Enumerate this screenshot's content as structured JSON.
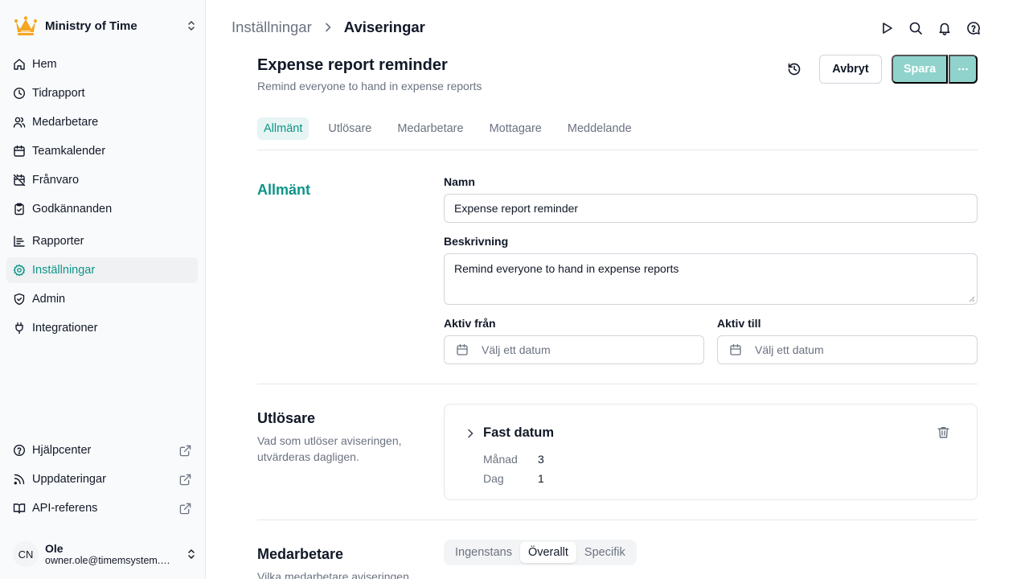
{
  "org": {
    "name": "Ministry of Time"
  },
  "sidebar": {
    "items": [
      {
        "label": "Hem",
        "icon": "home-icon"
      },
      {
        "label": "Tidrapport",
        "icon": "clock-icon"
      },
      {
        "label": "Medarbetare",
        "icon": "users-icon"
      },
      {
        "label": "Teamkalender",
        "icon": "calendar-icon"
      },
      {
        "label": "Frånvaro",
        "icon": "calendar-off-icon"
      },
      {
        "label": "Godkännanden",
        "icon": "clipboard-check-icon"
      },
      {
        "label": "Rapporter",
        "icon": "chart-icon"
      },
      {
        "label": "Inställningar",
        "icon": "gear-icon",
        "active": true
      },
      {
        "label": "Admin",
        "icon": "shield-check-icon"
      },
      {
        "label": "Integrationer",
        "icon": "plug-icon"
      }
    ],
    "footer": [
      {
        "label": "Hjälpcenter",
        "icon": "help-circle-icon"
      },
      {
        "label": "Uppdateringar",
        "icon": "rss-icon"
      },
      {
        "label": "API-referens",
        "icon": "book-icon"
      }
    ]
  },
  "user": {
    "initials": "CN",
    "name": "Ole",
    "email": "owner.ole@timemsystem.com"
  },
  "breadcrumb": {
    "parent": "Inställningar",
    "current": "Aviseringar"
  },
  "page": {
    "title": "Expense report reminder",
    "subtitle": "Remind everyone to hand in expense reports",
    "cancel_label": "Avbryt",
    "save_label": "Spara"
  },
  "tabs": [
    "Allmänt",
    "Utlösare",
    "Medarbetare",
    "Mottagare",
    "Meddelande"
  ],
  "general": {
    "title": "Allmänt",
    "name_label": "Namn",
    "name_value": "Expense report reminder",
    "description_label": "Beskrivning",
    "description_value": "Remind everyone to hand in expense reports",
    "active_from_label": "Aktiv från",
    "active_to_label": "Aktiv till",
    "date_placeholder": "Välj ett datum"
  },
  "trigger": {
    "title": "Utlösare",
    "description": "Vad som utlöser aviseringen, utvärderas dagligen.",
    "card_title": "Fast datum",
    "month_label": "Månad",
    "month_value": "3",
    "day_label": "Dag",
    "day_value": "1"
  },
  "employees": {
    "title": "Medarbetare",
    "description": "Vilka medarbetare aviseringen",
    "options": [
      "Ingenstans",
      "Överallt",
      "Specifik"
    ],
    "selected": "Överallt"
  },
  "colors": {
    "accent": "#0d9488",
    "save_disabled": "#8fd3cc",
    "crown": "#f5a623"
  }
}
